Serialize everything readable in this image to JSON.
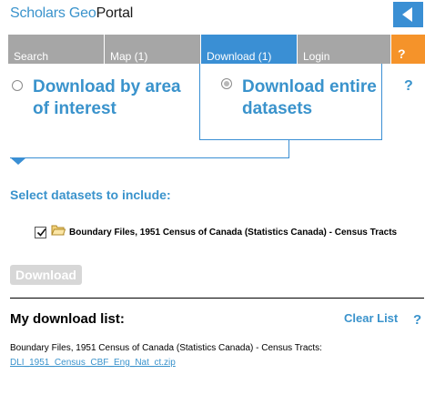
{
  "header": {
    "logo_part1": "Scholars ",
    "logo_part2": "Geo",
    "logo_part3": "Portal",
    "accent": "#3a8fd4",
    "collapse_icon": "chevron-left-icon"
  },
  "tabs": [
    {
      "label": "Search",
      "active": false
    },
    {
      "label": "Map (1)",
      "active": false
    },
    {
      "label": "Download (1)",
      "active": true
    },
    {
      "label": "Login",
      "active": false
    },
    {
      "label": "?",
      "active": false
    }
  ],
  "options": {
    "area_line1": "Download by area",
    "area_line2": "of interest",
    "entire_line1": "Download entire",
    "entire_line2": "datasets",
    "selected": "entire",
    "help": "?"
  },
  "datasets": {
    "title": "Select datasets to include:",
    "items": [
      {
        "label": "Boundary Files, 1951 Census of Canada (Statistics Canada) - Census Tracts",
        "checked": true
      }
    ]
  },
  "download_button": "Download",
  "download_list": {
    "title": "My download list:",
    "clear_label": "Clear List",
    "help": "?",
    "entries": [
      {
        "text": "Boundary Files, 1951 Census of Canada (Statistics Canada) - Census Tracts:",
        "link": "DLI_1951_Census_CBF_Eng_Nat_ct.zip"
      }
    ]
  }
}
